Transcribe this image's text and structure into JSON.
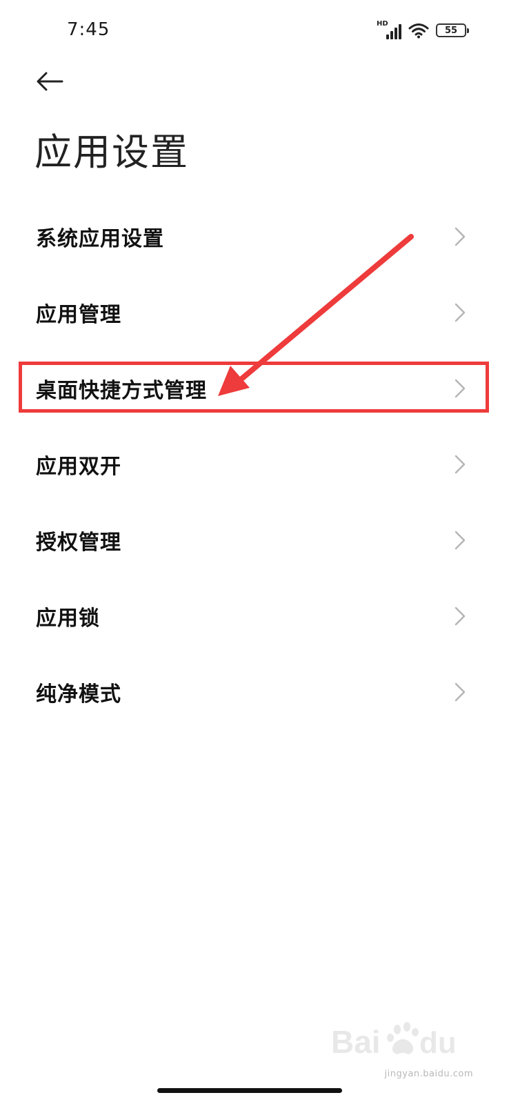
{
  "status_bar": {
    "time": "7:45",
    "network_label": "HD",
    "battery_level": "55"
  },
  "header": {
    "back_icon": "arrow-left-icon",
    "title": "应用设置"
  },
  "settings": {
    "items": [
      {
        "label": "系统应用设置",
        "icon": "chevron-right-icon"
      },
      {
        "label": "应用管理",
        "icon": "chevron-right-icon"
      },
      {
        "label": "桌面快捷方式管理",
        "icon": "chevron-right-icon",
        "highlighted": true
      },
      {
        "label": "应用双开",
        "icon": "chevron-right-icon"
      },
      {
        "label": "授权管理",
        "icon": "chevron-right-icon"
      },
      {
        "label": "应用锁",
        "icon": "chevron-right-icon"
      },
      {
        "label": "纯净模式",
        "icon": "chevron-right-icon"
      }
    ]
  },
  "annotation": {
    "color": "#ee3b3b"
  },
  "watermark": {
    "url": "jingyan.baidu.com"
  }
}
